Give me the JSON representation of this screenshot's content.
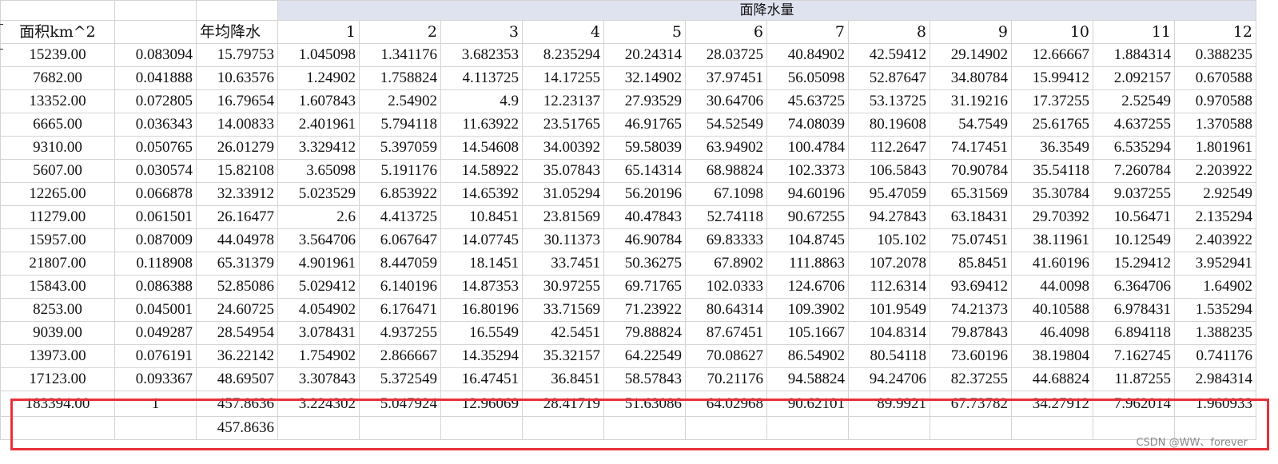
{
  "sheet": {
    "group_header": "面降水量",
    "headers": [
      "面积km^2",
      "",
      "年均降水",
      "1",
      "2",
      "3",
      "4",
      "5",
      "6",
      "7",
      "8",
      "9",
      "10",
      "11",
      "12"
    ],
    "rows": [
      [
        "15239.00",
        "0.083094",
        "15.79753",
        "1.045098",
        "1.341176",
        "3.682353",
        "8.235294",
        "20.24314",
        "28.03725",
        "40.84902",
        "42.59412",
        "29.14902",
        "12.66667",
        "1.884314",
        "0.388235"
      ],
      [
        "7682.00",
        "0.041888",
        "10.63576",
        "1.24902",
        "1.758824",
        "4.113725",
        "14.17255",
        "32.14902",
        "37.97451",
        "56.05098",
        "52.87647",
        "34.80784",
        "15.99412",
        "2.092157",
        "0.670588"
      ],
      [
        "13352.00",
        "0.072805",
        "16.79654",
        "1.607843",
        "2.54902",
        "4.9",
        "12.23137",
        "27.93529",
        "30.64706",
        "45.63725",
        "53.13725",
        "31.19216",
        "17.37255",
        "2.52549",
        "0.970588"
      ],
      [
        "6665.00",
        "0.036343",
        "14.00833",
        "2.401961",
        "5.794118",
        "11.63922",
        "23.51765",
        "46.91765",
        "54.52549",
        "74.08039",
        "80.19608",
        "54.7549",
        "25.61765",
        "4.637255",
        "1.370588"
      ],
      [
        "9310.00",
        "0.050765",
        "26.01279",
        "3.329412",
        "5.397059",
        "14.54608",
        "34.00392",
        "59.58039",
        "63.94902",
        "100.4784",
        "112.2647",
        "74.17451",
        "36.3549",
        "6.535294",
        "1.801961"
      ],
      [
        "5607.00",
        "0.030574",
        "15.82108",
        "3.65098",
        "5.191176",
        "14.58922",
        "35.07843",
        "65.14314",
        "68.98824",
        "102.3373",
        "106.5843",
        "70.90784",
        "35.54118",
        "7.260784",
        "2.203922"
      ],
      [
        "12265.00",
        "0.066878",
        "32.33912",
        "5.023529",
        "6.853922",
        "14.65392",
        "31.05294",
        "56.20196",
        "67.1098",
        "94.60196",
        "95.47059",
        "65.31569",
        "35.30784",
        "9.037255",
        "2.92549"
      ],
      [
        "11279.00",
        "0.061501",
        "26.16477",
        "2.6",
        "4.413725",
        "10.8451",
        "23.81569",
        "40.47843",
        "52.74118",
        "90.67255",
        "94.27843",
        "63.18431",
        "29.70392",
        "10.56471",
        "2.135294"
      ],
      [
        "15957.00",
        "0.087009",
        "44.04978",
        "3.564706",
        "6.067647",
        "14.07745",
        "30.11373",
        "46.90784",
        "69.83333",
        "104.8745",
        "105.102",
        "75.07451",
        "38.11961",
        "10.12549",
        "2.403922"
      ],
      [
        "21807.00",
        "0.118908",
        "65.31379",
        "4.901961",
        "8.447059",
        "18.1451",
        "33.7451",
        "50.36275",
        "67.8902",
        "111.8863",
        "107.2078",
        "85.8451",
        "41.60196",
        "15.29412",
        "3.952941"
      ],
      [
        "15843.00",
        "0.086388",
        "52.85086",
        "5.029412",
        "6.140196",
        "14.87353",
        "30.97255",
        "69.71765",
        "102.0333",
        "124.6706",
        "112.6314",
        "93.69412",
        "44.0098",
        "6.364706",
        "1.64902"
      ],
      [
        "8253.00",
        "0.045001",
        "24.60725",
        "4.054902",
        "6.176471",
        "16.80196",
        "33.71569",
        "71.23922",
        "80.64314",
        "109.3902",
        "101.9549",
        "74.21373",
        "40.10588",
        "6.978431",
        "1.535294"
      ],
      [
        "9039.00",
        "0.049287",
        "28.54954",
        "3.078431",
        "4.937255",
        "16.5549",
        "42.5451",
        "79.88824",
        "87.67451",
        "105.1667",
        "104.8314",
        "79.87843",
        "46.4098",
        "6.894118",
        "1.388235"
      ],
      [
        "13973.00",
        "0.076191",
        "36.22142",
        "1.754902",
        "2.866667",
        "14.35294",
        "35.32157",
        "64.22549",
        "70.08627",
        "86.54902",
        "80.54118",
        "73.60196",
        "38.19804",
        "7.162745",
        "0.741176"
      ],
      [
        "17123.00",
        "0.093367",
        "48.69507",
        "3.307843",
        "5.372549",
        "16.47451",
        "36.8451",
        "58.57843",
        "70.21176",
        "94.58824",
        "94.24706",
        "82.37255",
        "44.68824",
        "11.87255",
        "2.984314"
      ]
    ],
    "total_row": [
      "183394.00",
      "1",
      "457.8636",
      "3.224302",
      "5.047924",
      "12.96069",
      "28.41719",
      "51.63086",
      "64.02968",
      "90.62101",
      "89.9921",
      "67.73782",
      "34.27912",
      "7.962014",
      "1.960933"
    ],
    "extra_row_value": "457.8636"
  },
  "watermark": "CSDN @WW、forever",
  "colors": {
    "group_header_bg": "#dfe3f0",
    "highlight_border": "#e8303a",
    "gridline": "#d4d4d4"
  }
}
